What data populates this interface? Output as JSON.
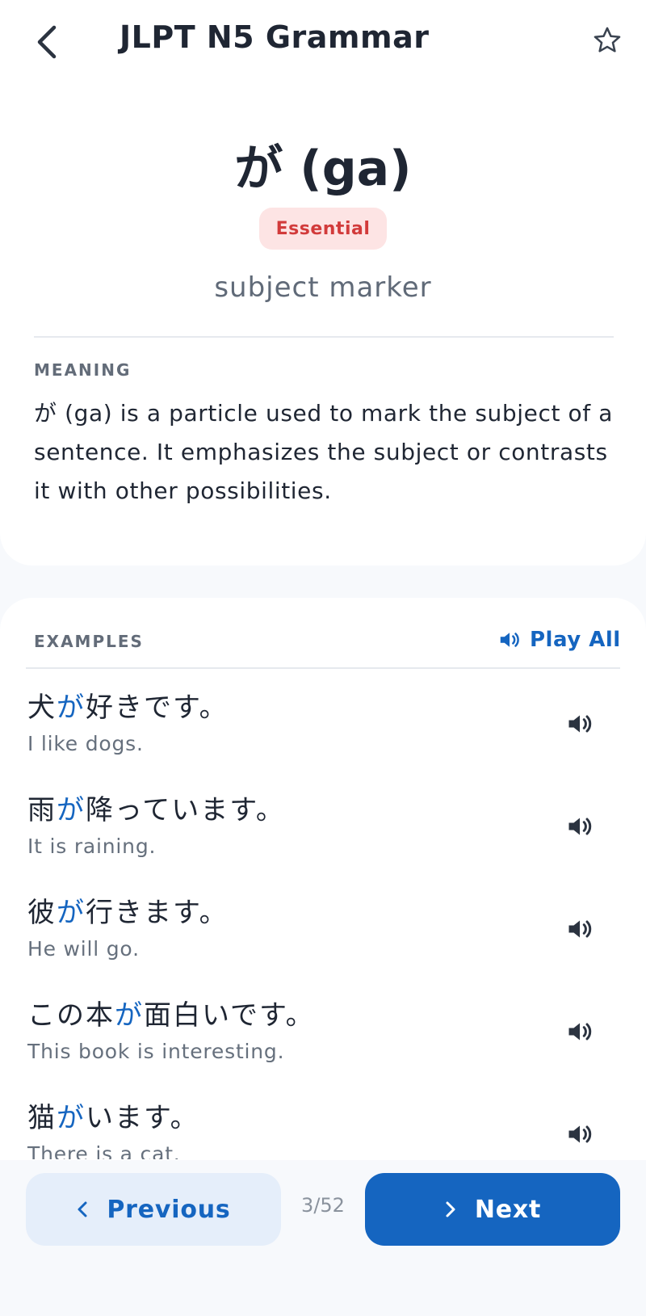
{
  "header": {
    "title": "JLPT N5 Grammar",
    "back_icon": "chevron-left-icon",
    "favorite_icon": "star-outline-icon"
  },
  "grammar": {
    "title": "が (ga)",
    "badge": "Essential",
    "subtitle": "subject marker"
  },
  "meaning": {
    "label": "MEANING",
    "text": "が (ga) is a particle used to mark the subject of a sentence. It emphasizes the subject or contrasts it with other possibilities."
  },
  "examples": {
    "label": "EXAMPLES",
    "play_all_label": "Play All",
    "items": [
      {
        "jp_before": "犬",
        "jp_particle": "が",
        "jp_after": "好きです。",
        "en": "I like dogs."
      },
      {
        "jp_before": "雨",
        "jp_particle": "が",
        "jp_after": "降っています。",
        "en": "It is raining."
      },
      {
        "jp_before": "彼",
        "jp_particle": "が",
        "jp_after": "行きます。",
        "en": "He will go."
      },
      {
        "jp_before": "この本",
        "jp_particle": "が",
        "jp_after": "面白いです。",
        "en": "This book is interesting."
      },
      {
        "jp_before": "猫",
        "jp_particle": "が",
        "jp_after": "います。",
        "en": "There is a cat."
      }
    ]
  },
  "nav": {
    "previous_label": "Previous",
    "next_label": "Next",
    "counter": "3/52"
  },
  "colors": {
    "accent": "#1565c0",
    "badge_bg": "#fde4e4",
    "badge_text": "#d23b3b",
    "text_primary": "#1f2633",
    "text_secondary": "#66707d"
  }
}
